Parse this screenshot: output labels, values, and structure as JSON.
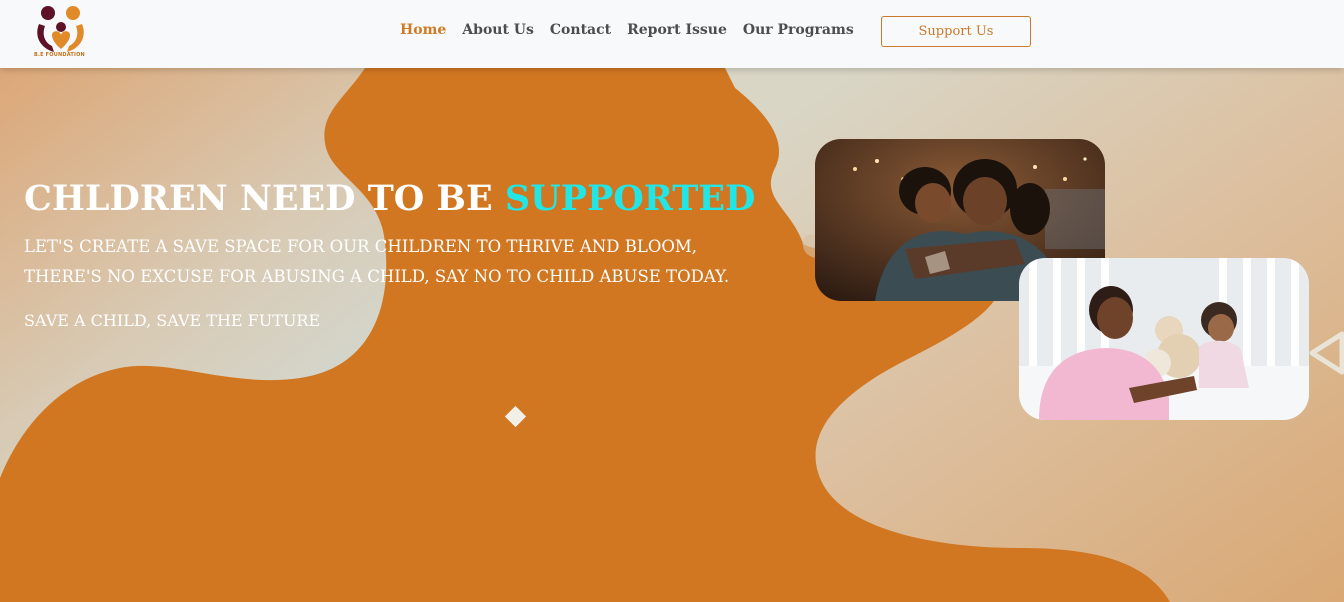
{
  "brand": {
    "logo_text": "B.E FOUNDATION"
  },
  "nav": {
    "items": [
      {
        "label": "Home",
        "active": true
      },
      {
        "label": "About Us",
        "active": false
      },
      {
        "label": "Contact",
        "active": false
      },
      {
        "label": "Report Issue",
        "active": false
      },
      {
        "label": "Our Programs",
        "active": false
      }
    ]
  },
  "header": {
    "support_label": "Support Us"
  },
  "hero": {
    "title_main": "CHLDREN NEED TO BE ",
    "title_accent": "SUPPORTED",
    "subtitle_line1": "LET'S CREATE A SAVE SPACE FOR OUR CHILDREN TO THRIVE AND BLOOM,",
    "subtitle_line2": "THERE'S NO EXCUSE FOR ABUSING A CHILD, SAY NO TO CHILD ABUSE TODAY.",
    "tagline": "SAVE A CHILD, SAVE THE FUTURE"
  },
  "colors": {
    "brand_orange": "#d17721",
    "accent_cyan": "#22e6e6",
    "nav_active": "#d17a24",
    "logo_maroon": "#5e1228"
  },
  "icons": [
    "logo-icon",
    "carousel-diamond-icon",
    "arrow-left-icon"
  ]
}
